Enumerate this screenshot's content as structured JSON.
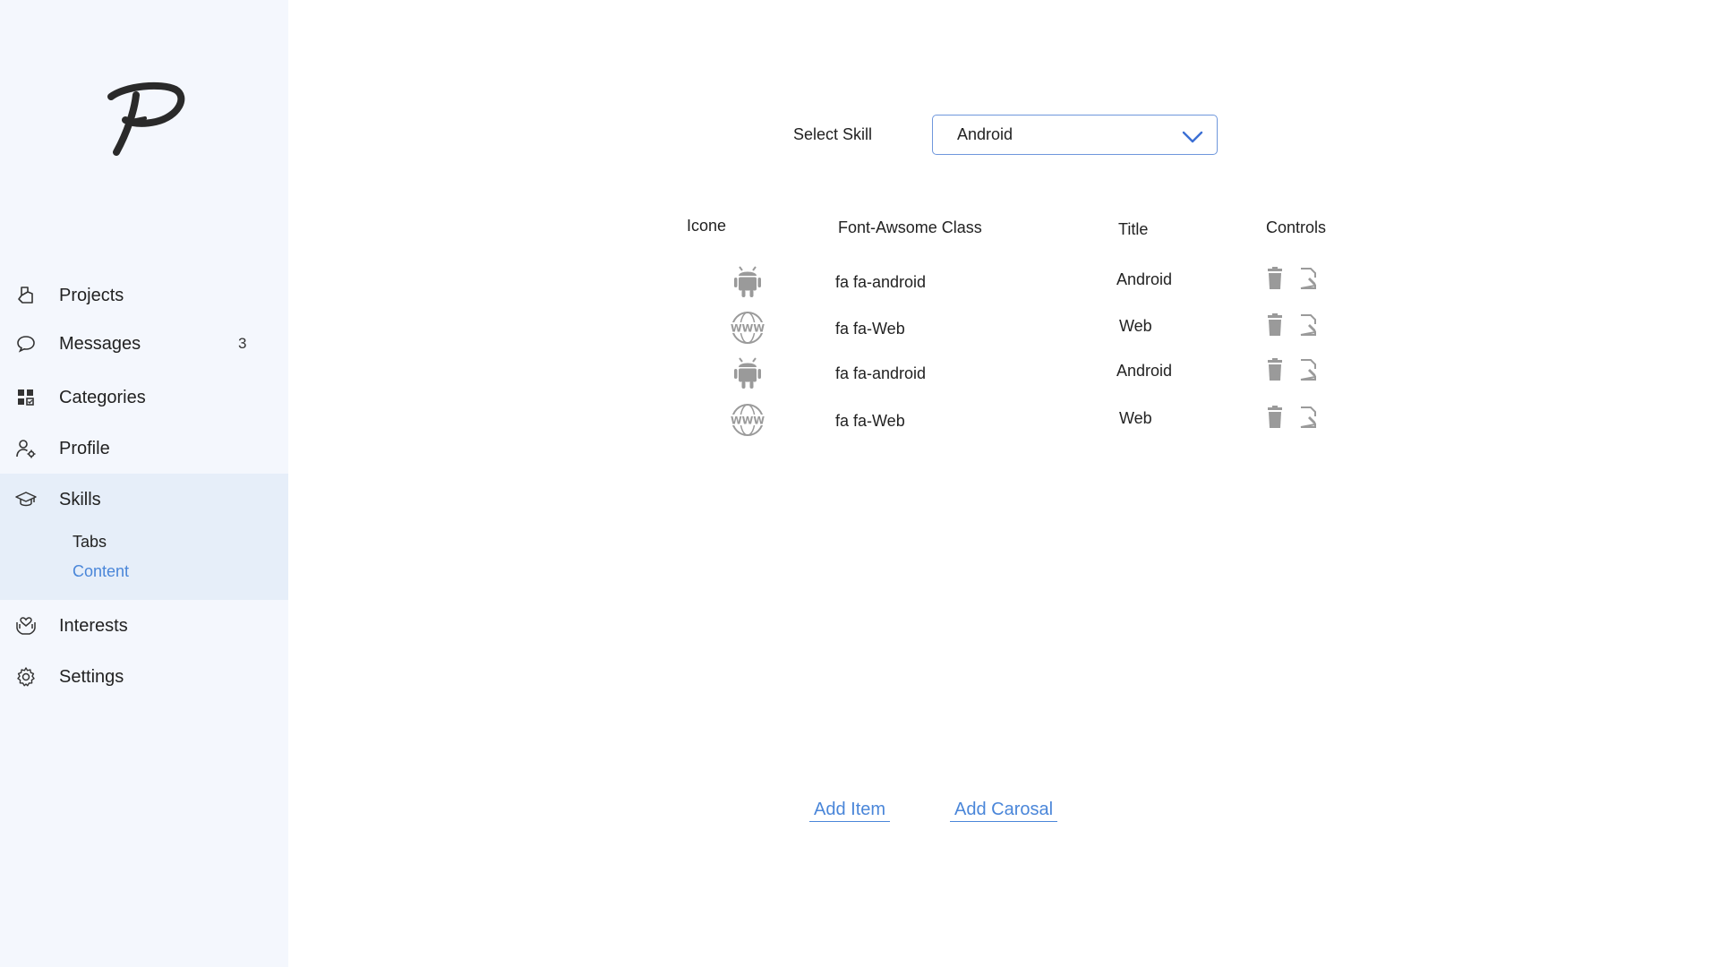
{
  "sidebar": {
    "logo_icon": "signature-p-logo",
    "items": [
      {
        "label": "Projects",
        "icon": "projects-icon"
      },
      {
        "label": "Messages",
        "icon": "chat-bubble-icon",
        "badge": "3"
      },
      {
        "label": "Categories",
        "icon": "categories-icon"
      },
      {
        "label": "Profile",
        "icon": "profile-settings-icon"
      },
      {
        "label": "Skills",
        "icon": "graduation-cap-icon",
        "sub_items": [
          {
            "label": "Tabs",
            "active": false
          },
          {
            "label": "Content",
            "active": true
          }
        ]
      },
      {
        "label": "Interests",
        "icon": "heart-hand-icon"
      },
      {
        "label": "Settings",
        "icon": "gear-icon"
      }
    ]
  },
  "main": {
    "select_label": "Select Skill",
    "select_value": "Android",
    "table": {
      "headers": [
        "Icone",
        "Font-Awsome Class",
        "Title",
        "Controls"
      ],
      "rows": [
        {
          "icon": "android-icon",
          "class": "fa fa-android",
          "title": "Android"
        },
        {
          "icon": "www-globe-icon",
          "class": "fa fa-Web",
          "title": "Web"
        },
        {
          "icon": "android-icon",
          "class": "fa fa-android",
          "title": "Android"
        },
        {
          "icon": "www-globe-icon",
          "class": "fa fa-Web",
          "title": "Web"
        }
      ]
    },
    "add_item_label": "Add Item",
    "add_carosal_label": "Add Carosal"
  },
  "colors": {
    "sidebar_bg": "#f4f7fd",
    "active_group_bg": "#e6eef9",
    "accent": "#4a86d9",
    "select_border": "#6f97dc",
    "icon_gray": "#9a9a9a"
  }
}
